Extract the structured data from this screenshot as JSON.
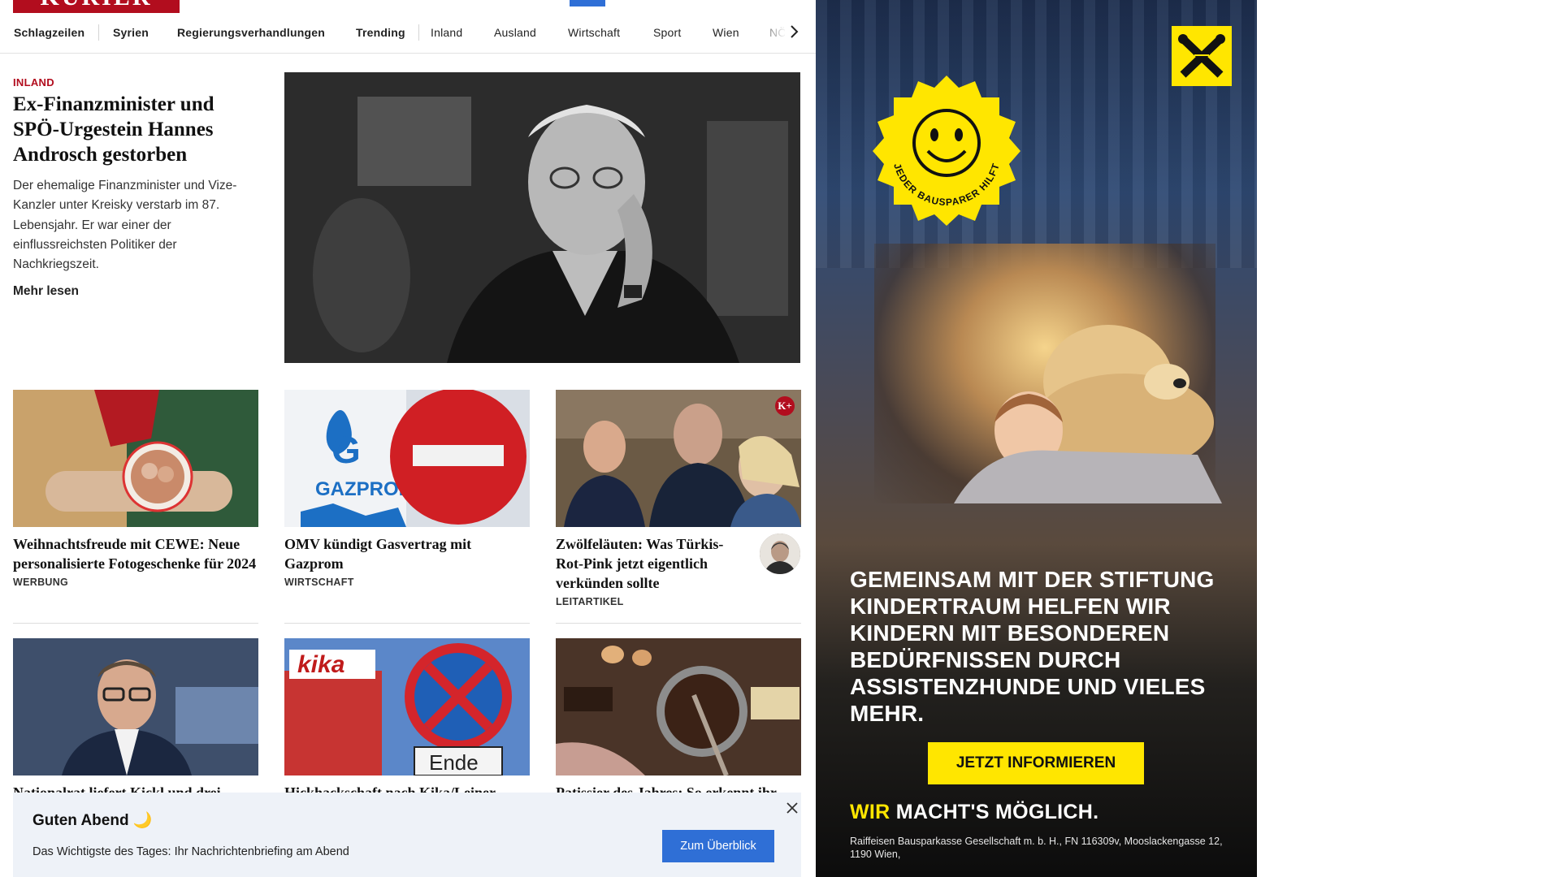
{
  "site": {
    "logo_text": "KURIER"
  },
  "nav": {
    "items": [
      {
        "label": "Schlagzeilen"
      },
      {
        "label": "Syrien"
      },
      {
        "label": "Regierungsverhandlungen"
      },
      {
        "label": "Trending"
      },
      {
        "label": "Inland"
      },
      {
        "label": "Ausland"
      },
      {
        "label": "Wirtschaft"
      },
      {
        "label": "Sport"
      },
      {
        "label": "Wien"
      },
      {
        "label": "NÖ"
      }
    ]
  },
  "hero": {
    "kicker": "INLAND",
    "title": "Ex-Finanzminister und SPÖ-Urgestein Hannes Androsch gestorben",
    "teaser": "Der ehemalige Finanzminister und Vize-Kanzler unter Kreisky verstarb im 87. Lebensjahr. Er war einer der einflussreichsten Politiker der Nachkriegszeit.",
    "more": "Mehr lesen"
  },
  "cards": [
    {
      "title": "Weihnachtsfreude mit CEWE: Neue personalisierte Fotogeschenke für 2024",
      "label": "WERBUNG"
    },
    {
      "title": "OMV kündigt Gasvertrag mit Gazprom",
      "label": "WIRTSCHAFT",
      "image_text": "GAZPROM"
    },
    {
      "title": "Zwölfeläuten: Was Türkis-Rot-Pink jetzt eigentlich verkünden sollte",
      "label": "LEITARTIKEL",
      "badge": "K+"
    },
    {
      "title": "Nationalrat liefert Kickl und drei"
    },
    {
      "title": "Hickhackschaft nach Kika/Leiner"
    },
    {
      "title": "Patissier des Jahres: So erkennt ihr"
    }
  ],
  "card_image_texts": {
    "kika": "kika",
    "ende": "Ende"
  },
  "newsletter": {
    "greeting": "Guten Abend 🌙",
    "description": "Das Wichtigste des Tages: Ihr Nachrichtenbriefing am Abend",
    "cta": "Zum Überblick"
  },
  "ad": {
    "badge_text": "JEDER BAUSPARER HILFT",
    "headline": "GEMEINSAM MIT DER STIFTUNG KINDERTRAUM HELFEN WIR KINDERN MIT BESONDEREN BEDÜRFNISSEN DURCH ASSISTENZHUNDE UND VIELES MEHR.",
    "cta": "JETZT INFORMIEREN",
    "slogan_highlight": "WIR",
    "slogan_rest": " MACHT'S MÖGLICH.",
    "legal": "Raiffeisen Bausparkasse Gesellschaft m. b. H., FN 116309v, Mooslackengasse 12, 1190 Wien,",
    "brand_color": "#ffe600"
  },
  "colors": {
    "brand_red": "#b20d1e",
    "accent_blue": "#2f6fd6",
    "toast_bg": "#eef2f8"
  },
  "icons": {
    "nav_next": "chevron-right-icon",
    "toast_close": "close-icon",
    "ad_logo": "raiffeisen-giebelkreuz-icon"
  }
}
